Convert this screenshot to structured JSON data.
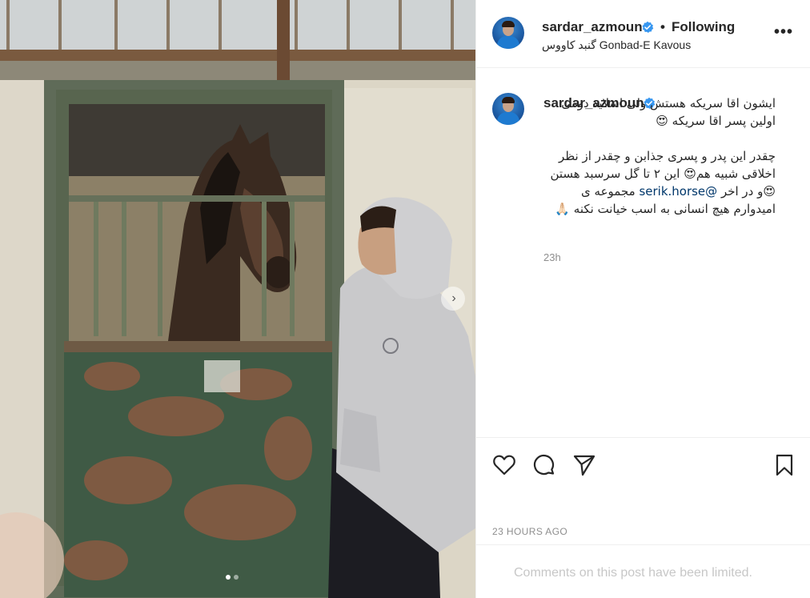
{
  "post": {
    "dots_count": 2,
    "active_dot": 0
  },
  "header": {
    "username": "sardar_azmoun",
    "separator": "•",
    "follow_status": "Following",
    "location": "گنبد کاووس Gonbad-E Kavous",
    "more_icon": "more-horizontal-icon",
    "more_glyph": "•••"
  },
  "caption": {
    "username": "sardar_azmoun",
    "paragraph1": "ایشون اقا سریکه هستش ولی اسلاید دومی اولین پسر اقا سریکه 😍",
    "paragraph2_before": "چقدر این پدر و پسری جذابن و چقدر از نظر اخلاقی شبیه هم😍 این ۲ تا گل سرسبد هستن 😍و در اخر ",
    "mention": "@serik.horse",
    "paragraph2_after": " مجموعه ی امیدوارم هیچ انسانی به اسب خیانت نکنه 🙏🏻",
    "age": "23h"
  },
  "actions": {
    "like_icon": "heart-icon",
    "comment_icon": "comment-icon",
    "share_icon": "send-icon",
    "save_icon": "bookmark-icon",
    "timestamp": "23 HOURS AGO"
  },
  "comments": {
    "limited_text": "Comments on this post have been limited."
  },
  "colors": {
    "verified": "#3897f0",
    "text": "#262626",
    "muted": "#8e8e8e",
    "link": "#00376b",
    "disabled": "#c7c7c7"
  }
}
